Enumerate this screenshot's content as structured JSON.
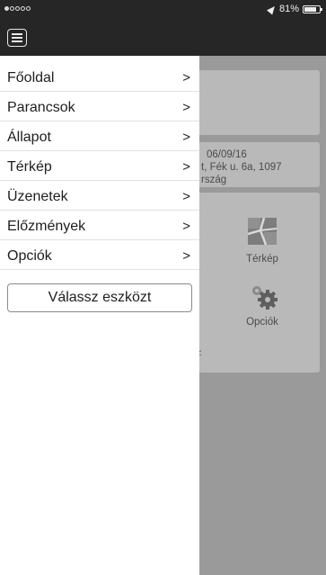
{
  "status_bar": {
    "battery_text": "81%",
    "battery_level": 0.81,
    "signal_dots_filled": 1,
    "signal_dots_total": 5
  },
  "menu": {
    "items": [
      {
        "label": "Főoldal",
        "chevron": ">"
      },
      {
        "label": "Parancsok",
        "chevron": ">"
      },
      {
        "label": "Állapot",
        "chevron": ">"
      },
      {
        "label": "Térkép",
        "chevron": ">"
      },
      {
        "label": "Üzenetek",
        "chevron": ">"
      },
      {
        "label": "Előzmények",
        "chevron": ">"
      },
      {
        "label": "Opciók",
        "chevron": ">"
      }
    ],
    "select_device_label": "Válassz eszközt"
  },
  "background": {
    "date": "06/09/16",
    "address_line": "t, Fék u. 6a, 1097",
    "country_fragment": "rszág",
    "tiles": [
      {
        "label": "Térkép",
        "icon": "map-icon"
      },
      {
        "label": "Opciók",
        "icon": "gear-icon"
      }
    ],
    "stray_char": "<"
  },
  "colors": {
    "bar": "#262626",
    "drawer": "#ffffff",
    "overlay": "#9a9a9a",
    "card": "#b9b9b9"
  }
}
